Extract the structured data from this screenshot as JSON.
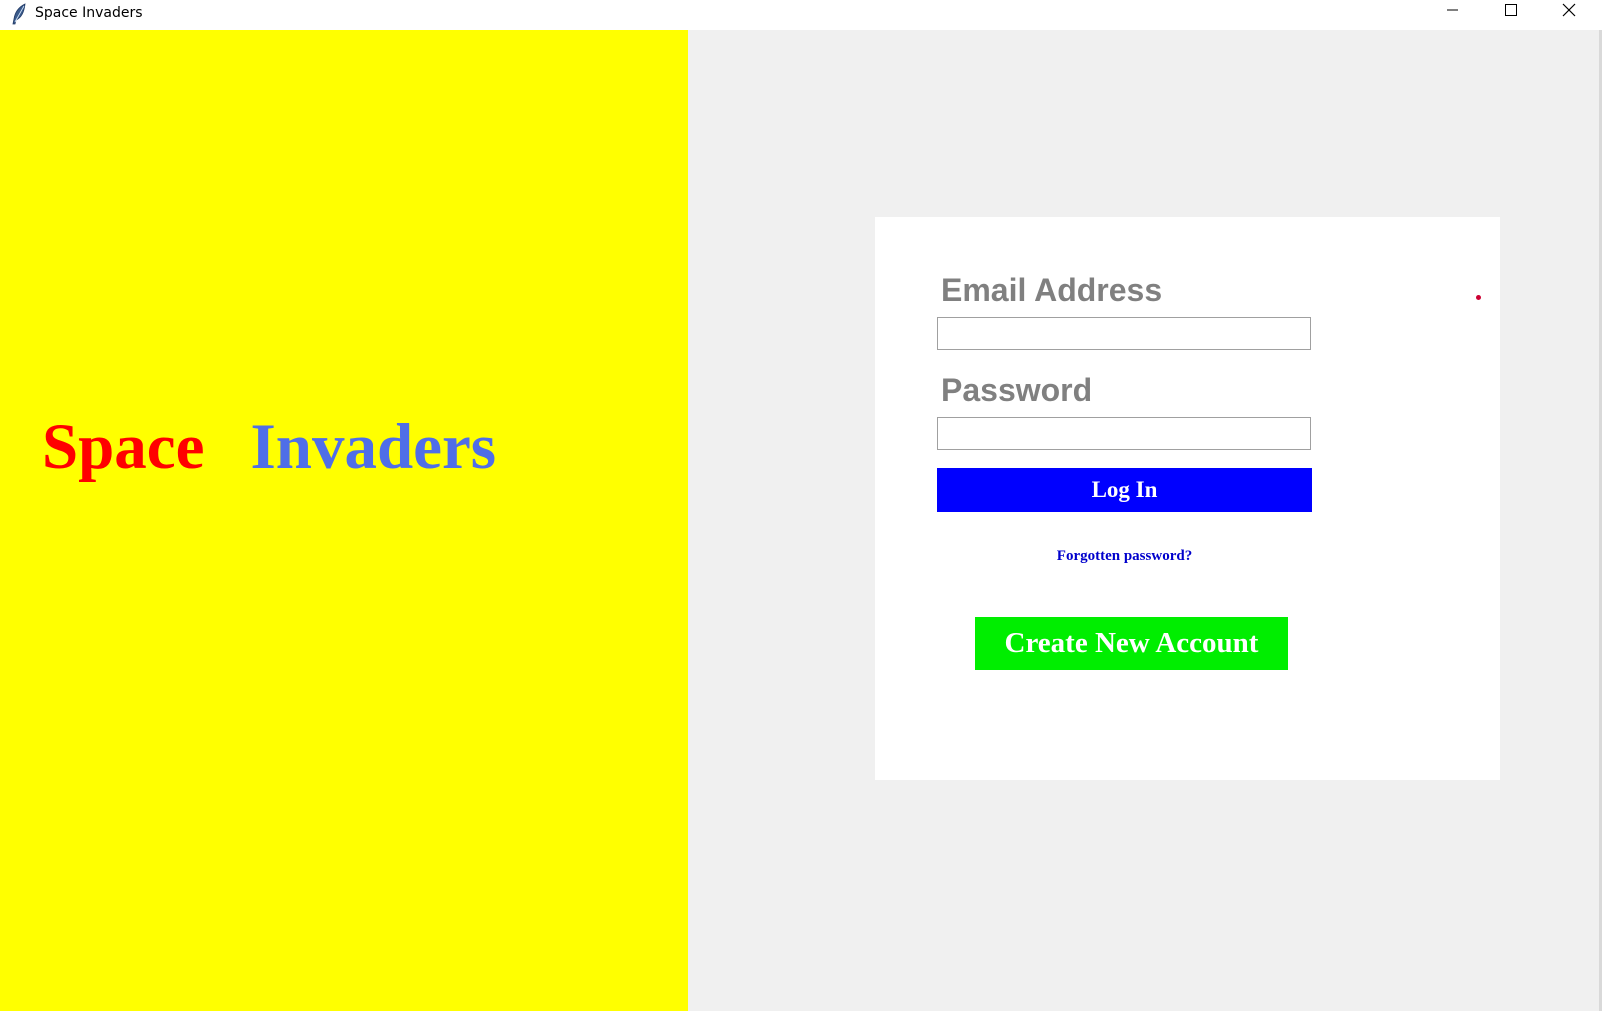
{
  "window": {
    "title": "Space Invaders",
    "icon": "feather-icon",
    "controls": [
      "minimize-icon",
      "maximize-icon",
      "close-icon"
    ]
  },
  "brand": {
    "word1": "Space",
    "word2": "Invaders",
    "word1_color": "#ff0000",
    "word2_color": "#4f6ee8",
    "panel_color": "#ffff00"
  },
  "login": {
    "email_label": "Email Address",
    "email_value": "",
    "password_label": "Password",
    "password_value": "",
    "login_button": "Log In",
    "login_button_color": "#0000ff",
    "forgot_password": "Forgotten password?",
    "create_account": "Create New Account",
    "create_account_color": "#00ee00"
  }
}
